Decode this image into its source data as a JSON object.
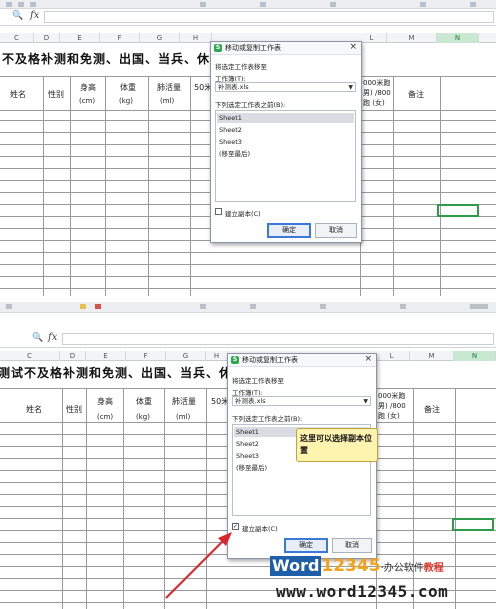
{
  "formula_bar": {
    "zoom_icon": "magnifier-icon",
    "fx_label": "fx"
  },
  "columns": [
    "C",
    "D",
    "E",
    "F",
    "G",
    "H",
    "I",
    "J",
    "K",
    "L",
    "M",
    "N"
  ],
  "sheet": {
    "title_top": "不及格补测和免测、出国、当兵、休学",
    "title_bottom": "测试不及格补测和免测、出国、当兵、休学",
    "headers": {
      "name": "姓名",
      "gender": "性别",
      "height": "身高",
      "height_unit": "(cm)",
      "weight": "体重",
      "weight_unit": "(kg)",
      "lung": "肺活量",
      "lung_unit": "(ml)",
      "run50": "50米",
      "run_long_1": "000米跑",
      "run_long_2": "男) /800",
      "run_long_3": "跑 (女)",
      "remarks": "备注"
    }
  },
  "dialog": {
    "title": "移动或复制工作表",
    "move_to_label": "将选定工作表移至",
    "workbook_label": "工作簿(T):",
    "workbook_value": "补测表.xls",
    "before_label": "下列选定工作表之前(B):",
    "sheets": [
      "Sheet1",
      "Sheet2",
      "Sheet3",
      "(移至最后)"
    ],
    "selected_sheet": "Sheet1",
    "copy_label": "建立副本(C)",
    "copy_checked_top": false,
    "copy_checked_bottom": true,
    "ok": "确定",
    "cancel": "取消",
    "close": "×"
  },
  "tooltip": "这里可以选择副本位置",
  "watermark": {
    "brand_word": "Word",
    "brand_num": "12345",
    "brand_suffix": "·办公软件",
    "brand_tag": "教程",
    "url": "www.word12345.com"
  },
  "colors": {
    "accent_green": "#2e9b4b",
    "tooltip_bg": "#fff3b0",
    "arrow": "#d9262c",
    "watermark_blue": "#1f5ea8",
    "watermark_orange": "#f2a21b"
  }
}
